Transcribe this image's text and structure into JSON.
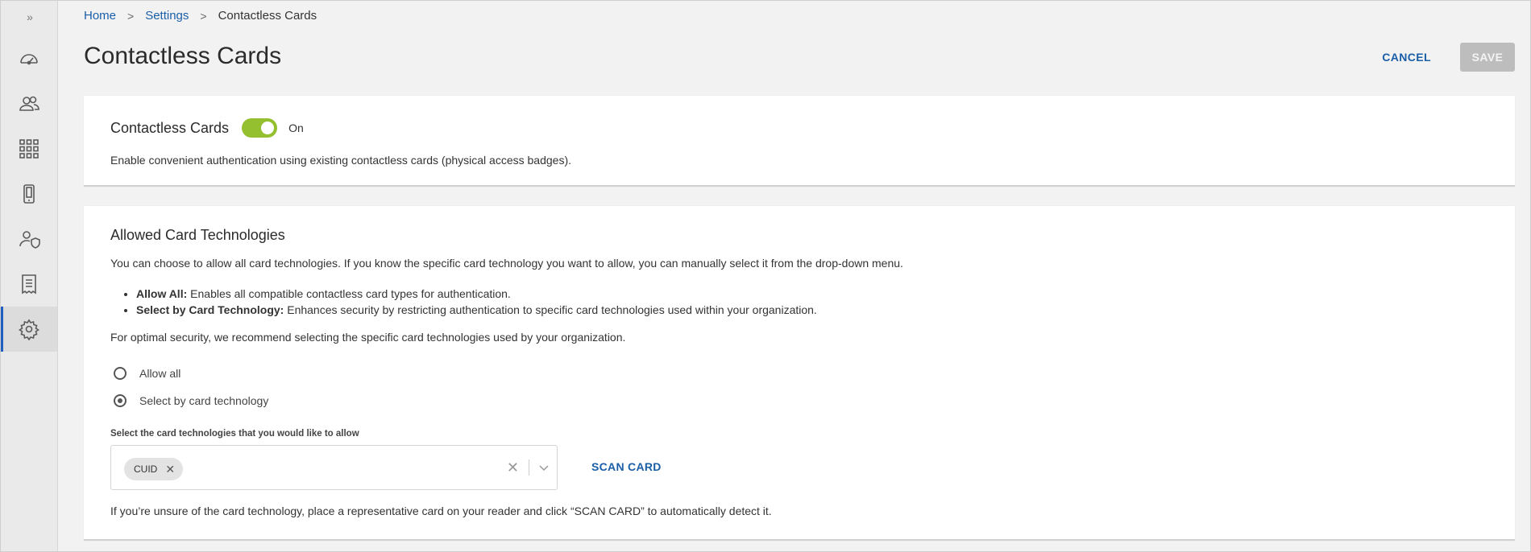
{
  "sidebar": {
    "expand_label": "»",
    "items": [
      {
        "name": "dashboard",
        "icon": "speedometer-icon",
        "active": false
      },
      {
        "name": "users",
        "icon": "users-icon",
        "active": false
      },
      {
        "name": "apps",
        "icon": "grid-icon",
        "active": false
      },
      {
        "name": "devices",
        "icon": "mobile-device-icon",
        "active": false
      },
      {
        "name": "admins",
        "icon": "user-shield-icon",
        "active": false
      },
      {
        "name": "reports",
        "icon": "report-icon",
        "active": false
      },
      {
        "name": "settings",
        "icon": "gear-icon",
        "active": true
      }
    ]
  },
  "breadcrumb": {
    "home": "Home",
    "settings": "Settings",
    "current": "Contactless Cards",
    "separator": ">"
  },
  "header": {
    "title": "Contactless Cards",
    "cancel_label": "CANCEL",
    "save_label": "SAVE"
  },
  "contactless": {
    "title": "Contactless Cards",
    "toggle_state": "On",
    "toggle_color": "#94bf2f",
    "description": "Enable convenient authentication using existing contactless cards (physical access badges)."
  },
  "technologies": {
    "title": "Allowed Card Technologies",
    "intro": "You can choose to allow all card technologies. If you know the specific card technology you want to allow, you can manually select it from the drop-down menu.",
    "bullets": [
      {
        "term": "Allow All:",
        "text": " Enables all compatible contactless card types for authentication."
      },
      {
        "term": "Select by Card Technology:",
        "text": " Enhances security by restricting authentication to specific card technologies used within your organization."
      }
    ],
    "recommendation": "For optimal security, we recommend selecting the specific card technologies used by your organization.",
    "options": [
      {
        "label": "Allow all",
        "checked": false
      },
      {
        "label": "Select by card technology",
        "checked": true
      }
    ],
    "select_label": "Select the card technologies that you would like to allow",
    "selected_chip": "CUID",
    "scan_label": "SCAN CARD",
    "hint": "If you’re unsure of the card technology, place a representative card on your reader and click “SCAN CARD” to automatically detect it."
  },
  "colors": {
    "link": "#1a5ea8",
    "accent": "#1f5fbf",
    "save_disabled": "#bdbdbd"
  }
}
